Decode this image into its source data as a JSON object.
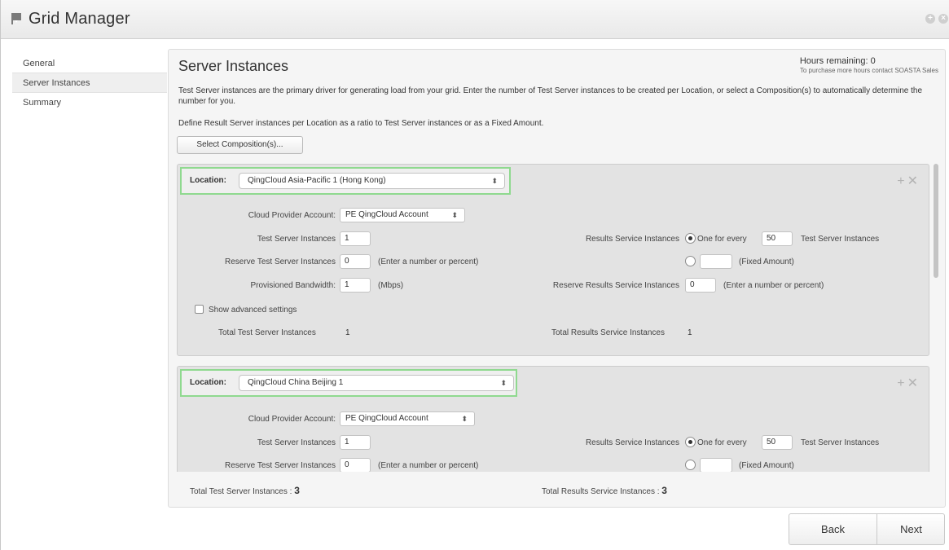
{
  "window": {
    "title": "Grid Manager"
  },
  "sidebar": {
    "items": [
      {
        "label": "General"
      },
      {
        "label": "Server Instances"
      },
      {
        "label": "Summary"
      }
    ]
  },
  "main": {
    "title": "Server Instances",
    "hours_remaining": "Hours remaining: 0",
    "hours_note": "To purchase more hours contact SOASTA Sales",
    "description": "Test Server instances are the primary driver for generating load from your grid. Enter the number of Test Server instances to be created per Location, or select a Composition(s) to automatically determine the number for you.",
    "description2": "Define Result Server instances per Location as a ratio to Test Server instances or as a Fixed Amount.",
    "select_composition_label": "Select Composition(s)..."
  },
  "labels": {
    "location": "Location:",
    "cloud_provider_account": "Cloud Provider Account:",
    "test_server_instances": "Test Server Instances",
    "reserve_test_server_instances": "Reserve Test Server Instances",
    "provisioned_bandwidth": "Provisioned Bandwidth:",
    "results_service_instances": "Results Service Instances",
    "one_for_every": "One for every",
    "test_server_instances_suffix": "Test Server Instances",
    "fixed_amount": "(Fixed Amount)",
    "reserve_results_service_instances": "Reserve Results Service Instances",
    "enter_number_or_percent": "(Enter a number or percent)",
    "mbps": "(Mbps)",
    "show_advanced_settings": "Show advanced settings",
    "total_test_server_instances": "Total Test Server Instances",
    "total_results_service_instances": "Total Results Service Instances"
  },
  "locations": [
    {
      "location": "QingCloud Asia-Pacific 1 (Hong Kong)",
      "account": "PE QingCloud Account",
      "test_server_instances": "1",
      "reserve_test_server_instances": "0",
      "provisioned_bandwidth": "1",
      "results_ratio": "50",
      "results_fixed": "",
      "reserve_results_service_instances": "0",
      "total_test_server_instances": "1",
      "total_results_service_instances": "1"
    },
    {
      "location": "QingCloud China Beijing 1",
      "account": "PE QingCloud Account",
      "test_server_instances": "1",
      "reserve_test_server_instances": "0",
      "results_ratio": "50",
      "results_fixed": ""
    }
  ],
  "footer": {
    "total_test_label": "Total Test Server Instances :",
    "total_test_value": "3",
    "total_results_label": "Total Results Service Instances :",
    "total_results_value": "3"
  },
  "nav": {
    "back": "Back",
    "next": "Next"
  },
  "icons": {
    "add": "+",
    "remove": "✕",
    "select_arrows": "⬍"
  }
}
